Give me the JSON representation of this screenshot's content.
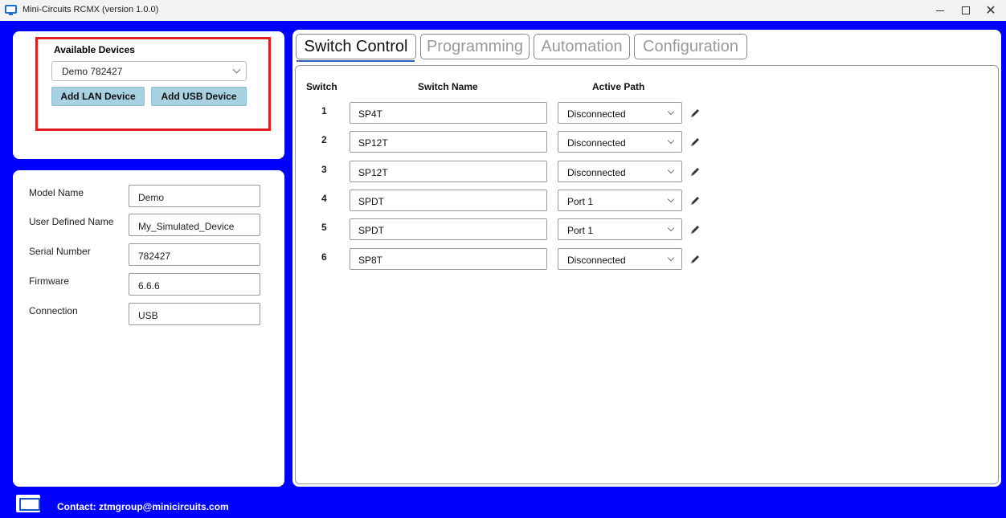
{
  "window": {
    "title": "Mini-Circuits RCMX (version 1.0.0)",
    "minimize_glyph": "–",
    "close_glyph": "✕"
  },
  "devices": {
    "title": "Available Devices",
    "selected": "Demo  782427",
    "add_lan_label": "Add LAN Device",
    "add_usb_label": "Add USB Device"
  },
  "info": {
    "fields": [
      {
        "label": "Model Name",
        "value": "Demo"
      },
      {
        "label": "User Defined Name",
        "value": "My_Simulated_Device"
      },
      {
        "label": "Serial Number",
        "value": "782427"
      },
      {
        "label": "Firmware",
        "value": "6.6.6"
      },
      {
        "label": "Connection",
        "value": "USB"
      }
    ]
  },
  "tabs": [
    {
      "label": "Switch Control",
      "active": true
    },
    {
      "label": "Programming",
      "active": false
    },
    {
      "label": "Automation",
      "active": false
    },
    {
      "label": "Configuration",
      "active": false
    }
  ],
  "table": {
    "headers": {
      "switch": "Switch",
      "name": "Switch Name",
      "path": "Active Path"
    },
    "rows": [
      {
        "num": "1",
        "name": "SP4T",
        "path": "Disconnected"
      },
      {
        "num": "2",
        "name": "SP12T",
        "path": "Disconnected"
      },
      {
        "num": "3",
        "name": "SP12T",
        "path": "Disconnected"
      },
      {
        "num": "4",
        "name": "SPDT",
        "path": "Port 1"
      },
      {
        "num": "5",
        "name": "SPDT",
        "path": "Port 1"
      },
      {
        "num": "6",
        "name": "SP8T",
        "path": "Disconnected"
      }
    ]
  },
  "footer": {
    "contact": "Contact: ztmgroup@minicircuits.com"
  },
  "colors": {
    "background": "#0000ff",
    "highlight_border": "#e02020",
    "button": "#a8d1e1",
    "active_tab_underline": "#2a5fbf"
  },
  "icons": [
    "app-icon",
    "chevron-down-icon",
    "pencil-icon",
    "monitor-icon"
  ]
}
